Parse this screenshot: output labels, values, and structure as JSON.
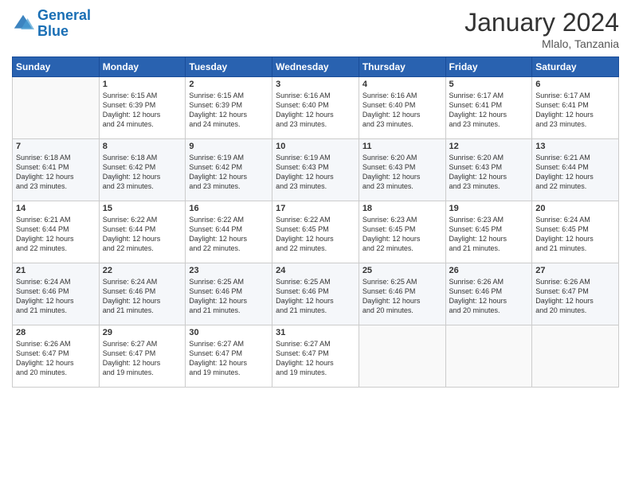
{
  "logo": {
    "line1": "General",
    "line2": "Blue"
  },
  "title": "January 2024",
  "location": "Mlalo, Tanzania",
  "days_of_week": [
    "Sunday",
    "Monday",
    "Tuesday",
    "Wednesday",
    "Thursday",
    "Friday",
    "Saturday"
  ],
  "weeks": [
    [
      {
        "day": "",
        "info": ""
      },
      {
        "day": "1",
        "info": "Sunrise: 6:15 AM\nSunset: 6:39 PM\nDaylight: 12 hours\nand 24 minutes."
      },
      {
        "day": "2",
        "info": "Sunrise: 6:15 AM\nSunset: 6:39 PM\nDaylight: 12 hours\nand 24 minutes."
      },
      {
        "day": "3",
        "info": "Sunrise: 6:16 AM\nSunset: 6:40 PM\nDaylight: 12 hours\nand 23 minutes."
      },
      {
        "day": "4",
        "info": "Sunrise: 6:16 AM\nSunset: 6:40 PM\nDaylight: 12 hours\nand 23 minutes."
      },
      {
        "day": "5",
        "info": "Sunrise: 6:17 AM\nSunset: 6:41 PM\nDaylight: 12 hours\nand 23 minutes."
      },
      {
        "day": "6",
        "info": "Sunrise: 6:17 AM\nSunset: 6:41 PM\nDaylight: 12 hours\nand 23 minutes."
      }
    ],
    [
      {
        "day": "7",
        "info": "Sunrise: 6:18 AM\nSunset: 6:41 PM\nDaylight: 12 hours\nand 23 minutes."
      },
      {
        "day": "8",
        "info": "Sunrise: 6:18 AM\nSunset: 6:42 PM\nDaylight: 12 hours\nand 23 minutes."
      },
      {
        "day": "9",
        "info": "Sunrise: 6:19 AM\nSunset: 6:42 PM\nDaylight: 12 hours\nand 23 minutes."
      },
      {
        "day": "10",
        "info": "Sunrise: 6:19 AM\nSunset: 6:43 PM\nDaylight: 12 hours\nand 23 minutes."
      },
      {
        "day": "11",
        "info": "Sunrise: 6:20 AM\nSunset: 6:43 PM\nDaylight: 12 hours\nand 23 minutes."
      },
      {
        "day": "12",
        "info": "Sunrise: 6:20 AM\nSunset: 6:43 PM\nDaylight: 12 hours\nand 23 minutes."
      },
      {
        "day": "13",
        "info": "Sunrise: 6:21 AM\nSunset: 6:44 PM\nDaylight: 12 hours\nand 22 minutes."
      }
    ],
    [
      {
        "day": "14",
        "info": "Sunrise: 6:21 AM\nSunset: 6:44 PM\nDaylight: 12 hours\nand 22 minutes."
      },
      {
        "day": "15",
        "info": "Sunrise: 6:22 AM\nSunset: 6:44 PM\nDaylight: 12 hours\nand 22 minutes."
      },
      {
        "day": "16",
        "info": "Sunrise: 6:22 AM\nSunset: 6:44 PM\nDaylight: 12 hours\nand 22 minutes."
      },
      {
        "day": "17",
        "info": "Sunrise: 6:22 AM\nSunset: 6:45 PM\nDaylight: 12 hours\nand 22 minutes."
      },
      {
        "day": "18",
        "info": "Sunrise: 6:23 AM\nSunset: 6:45 PM\nDaylight: 12 hours\nand 22 minutes."
      },
      {
        "day": "19",
        "info": "Sunrise: 6:23 AM\nSunset: 6:45 PM\nDaylight: 12 hours\nand 21 minutes."
      },
      {
        "day": "20",
        "info": "Sunrise: 6:24 AM\nSunset: 6:45 PM\nDaylight: 12 hours\nand 21 minutes."
      }
    ],
    [
      {
        "day": "21",
        "info": "Sunrise: 6:24 AM\nSunset: 6:46 PM\nDaylight: 12 hours\nand 21 minutes."
      },
      {
        "day": "22",
        "info": "Sunrise: 6:24 AM\nSunset: 6:46 PM\nDaylight: 12 hours\nand 21 minutes."
      },
      {
        "day": "23",
        "info": "Sunrise: 6:25 AM\nSunset: 6:46 PM\nDaylight: 12 hours\nand 21 minutes."
      },
      {
        "day": "24",
        "info": "Sunrise: 6:25 AM\nSunset: 6:46 PM\nDaylight: 12 hours\nand 21 minutes."
      },
      {
        "day": "25",
        "info": "Sunrise: 6:25 AM\nSunset: 6:46 PM\nDaylight: 12 hours\nand 20 minutes."
      },
      {
        "day": "26",
        "info": "Sunrise: 6:26 AM\nSunset: 6:46 PM\nDaylight: 12 hours\nand 20 minutes."
      },
      {
        "day": "27",
        "info": "Sunrise: 6:26 AM\nSunset: 6:47 PM\nDaylight: 12 hours\nand 20 minutes."
      }
    ],
    [
      {
        "day": "28",
        "info": "Sunrise: 6:26 AM\nSunset: 6:47 PM\nDaylight: 12 hours\nand 20 minutes."
      },
      {
        "day": "29",
        "info": "Sunrise: 6:27 AM\nSunset: 6:47 PM\nDaylight: 12 hours\nand 19 minutes."
      },
      {
        "day": "30",
        "info": "Sunrise: 6:27 AM\nSunset: 6:47 PM\nDaylight: 12 hours\nand 19 minutes."
      },
      {
        "day": "31",
        "info": "Sunrise: 6:27 AM\nSunset: 6:47 PM\nDaylight: 12 hours\nand 19 minutes."
      },
      {
        "day": "",
        "info": ""
      },
      {
        "day": "",
        "info": ""
      },
      {
        "day": "",
        "info": ""
      }
    ]
  ]
}
